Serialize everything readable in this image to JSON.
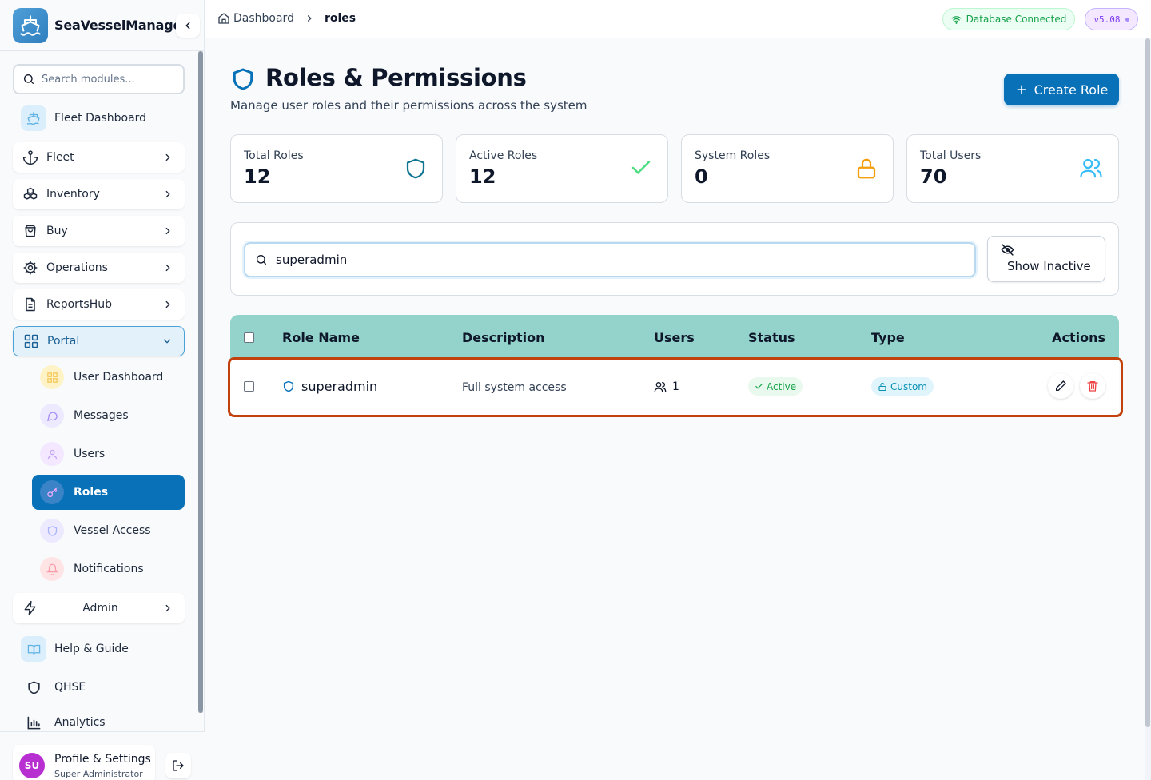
{
  "app": {
    "name": "SeaVesselManager"
  },
  "sidebar": {
    "search_placeholder": "Search modules...",
    "fleet_dashboard": "Fleet Dashboard",
    "sections": [
      {
        "label": "Fleet",
        "icon": "anchor-icon"
      },
      {
        "label": "Inventory",
        "icon": "boxes-icon"
      },
      {
        "label": "Buy",
        "icon": "shopping-bag-icon"
      },
      {
        "label": "Operations",
        "icon": "gear-icon"
      },
      {
        "label": "ReportsHub",
        "icon": "file-icon"
      }
    ],
    "portal": {
      "label": "Portal",
      "items": [
        {
          "label": "User Dashboard",
          "icon": "grid-icon"
        },
        {
          "label": "Messages",
          "icon": "chat-icon"
        },
        {
          "label": "Users",
          "icon": "user-icon"
        },
        {
          "label": "Roles",
          "icon": "key-icon"
        },
        {
          "label": "Vessel Access",
          "icon": "shield-icon"
        },
        {
          "label": "Notifications",
          "icon": "bell-icon"
        }
      ]
    },
    "admin": "Admin",
    "help": "Help & Guide",
    "qhse": "QHSE",
    "analytics": "Analytics",
    "profile": {
      "initials": "SU",
      "name": "Profile & Settings",
      "role": "Super Administrator"
    }
  },
  "topbar": {
    "breadcrumb_home": "Dashboard",
    "breadcrumb_current": "roles",
    "db_status": "Database Connected",
    "version": "v5.08"
  },
  "page": {
    "title": "Roles & Permissions",
    "subtitle": "Manage user roles and their permissions across the system",
    "create_button": "Create Role"
  },
  "stats": [
    {
      "label": "Total Roles",
      "value": "12",
      "icon": "shield-icon",
      "color": "#0e7490"
    },
    {
      "label": "Active Roles",
      "value": "12",
      "icon": "check-icon",
      "color": "#4ade80"
    },
    {
      "label": "System Roles",
      "value": "0",
      "icon": "lock-icon",
      "color": "#f59e0b"
    },
    {
      "label": "Total Users",
      "value": "70",
      "icon": "users-icon",
      "color": "#38bdf8"
    }
  ],
  "filter": {
    "search_value": "superadmin",
    "show_inactive": "Show Inactive"
  },
  "table": {
    "columns": [
      "Role Name",
      "Description",
      "Users",
      "Status",
      "Type",
      "Actions"
    ],
    "rows": [
      {
        "name": "superadmin",
        "description": "Full system access",
        "users": "1",
        "status": "Active",
        "type": "Custom"
      }
    ]
  },
  "colors": {
    "primary": "#0871b8",
    "header": "#93d3cc",
    "highlight": "#c2410c"
  }
}
